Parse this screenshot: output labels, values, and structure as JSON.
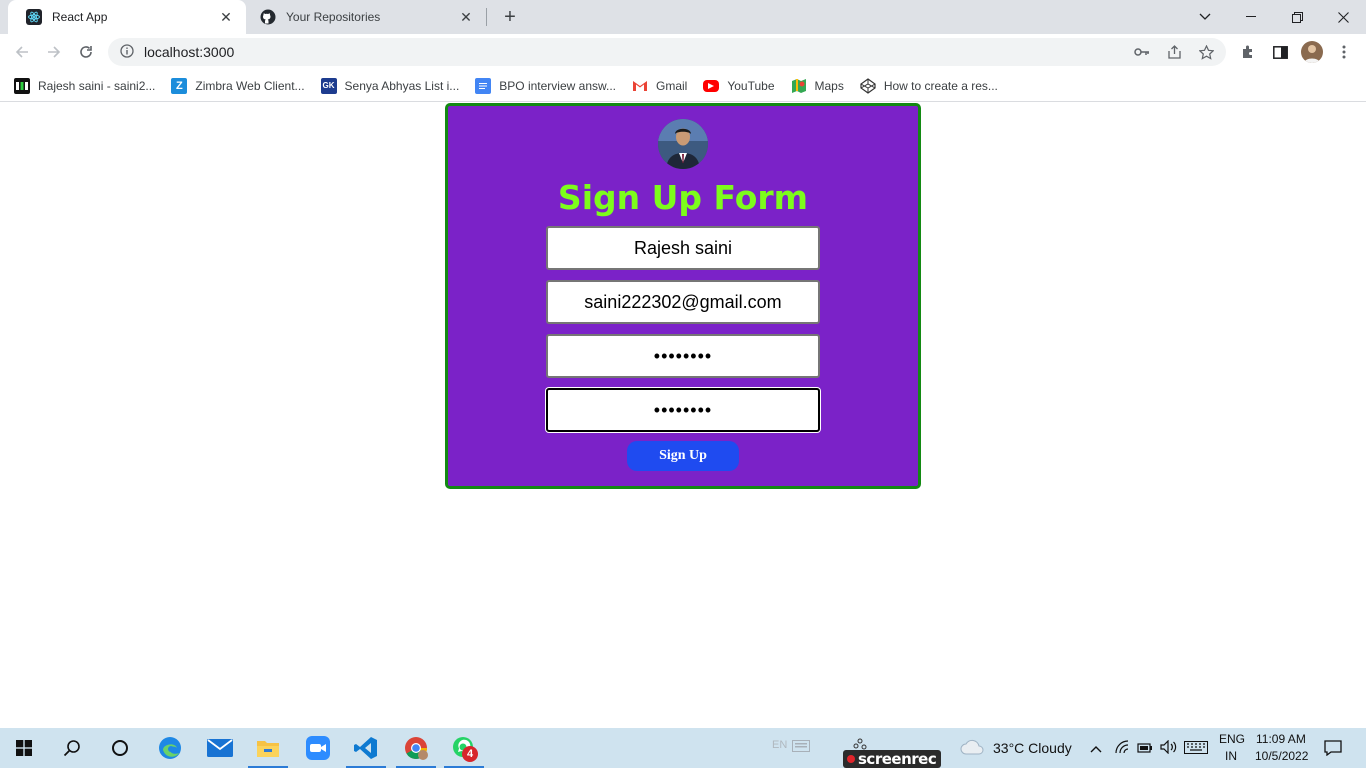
{
  "browser": {
    "tabs": [
      {
        "title": "React App",
        "active": true,
        "icon": "react-icon"
      },
      {
        "title": "Your Repositories",
        "active": false,
        "icon": "github-icon"
      }
    ],
    "url": "localhost:3000",
    "bookmarks": [
      {
        "label": "Rajesh saini - saini2...",
        "icon": "hashnode-icon"
      },
      {
        "label": "Zimbra Web Client...",
        "icon": "zimbra-icon"
      },
      {
        "label": "Senya Abhyas List i...",
        "icon": "gk-icon"
      },
      {
        "label": "BPO interview answ...",
        "icon": "docs-icon"
      },
      {
        "label": "Gmail",
        "icon": "gmail-icon"
      },
      {
        "label": "YouTube",
        "icon": "youtube-icon"
      },
      {
        "label": "Maps",
        "icon": "maps-icon"
      },
      {
        "label": "How to create a res...",
        "icon": "codepen-icon"
      }
    ]
  },
  "form": {
    "title": "Sign Up Form",
    "name_value": "Rajesh saini",
    "email_value": "saini222302@gmail.com",
    "password_value": "••••••••",
    "confirm_password_value": "••••••••",
    "submit_label": "Sign Up"
  },
  "taskbar": {
    "apps": [
      "start-icon",
      "search-icon",
      "cortana-icon",
      "edge-icon",
      "mail-icon",
      "file-explorer-icon",
      "zoom-icon",
      "vscode-icon",
      "chrome-icon",
      "whatsapp-icon"
    ],
    "whatsapp_badge": "4",
    "screenrec_label": "screenrec",
    "weather": "33°C  Cloudy",
    "lang_top": "ENG",
    "lang_bottom": "IN",
    "time": "11:09 AM",
    "date": "10/5/2022",
    "ghost_lang": "EN"
  },
  "colors": {
    "card_bg": "#7b22c8",
    "card_border": "#138a13",
    "title_color": "#7dfc1b",
    "button_bg": "#1f4bf0"
  }
}
